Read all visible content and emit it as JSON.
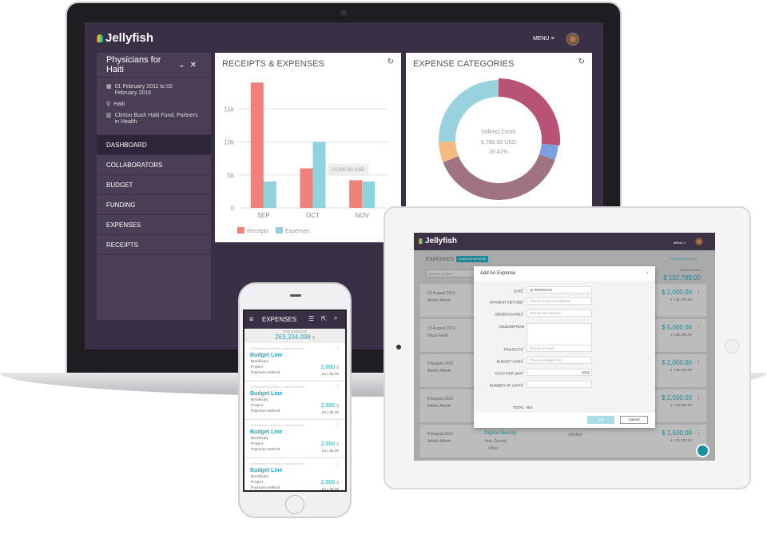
{
  "laptop": {
    "brand": "Jellyfish",
    "menu_label": "MENU",
    "project": "Physicians for Haiti",
    "dates": "01 February 2011 to 02 February 2016",
    "location": "Haiti",
    "funders": "Clinton Bush Haiti Fund, Partners in Health",
    "nav": [
      "DASHBOARD",
      "COLLABORATORS",
      "BUDGET",
      "FUNDING",
      "EXPENSES",
      "RECEIPTS"
    ],
    "active_nav": "DASHBOARD"
  },
  "chart_data": [
    {
      "type": "bar",
      "title": "RECEIPTS & EXPENSES",
      "categories": [
        "SEP",
        "OCT",
        "NOV"
      ],
      "series": [
        {
          "name": "Receipts",
          "values": [
            19000,
            6000,
            4200
          ],
          "color": "#f0817b"
        },
        {
          "name": "Expenses",
          "values": [
            4000,
            10000,
            4000
          ],
          "color": "#8fd3df"
        }
      ],
      "yticks": [
        0,
        5000,
        10000,
        15000
      ],
      "ytick_labels": [
        "0",
        "5k",
        "10k",
        "15k"
      ],
      "ylim": [
        0,
        20000
      ],
      "grid": true,
      "legend": "bottom-left",
      "tooltip": "10,000.00 USD"
    },
    {
      "type": "pie",
      "title": "EXPENSE CATEGORIES",
      "slices": [
        {
          "value": 26.41,
          "color": "#b85377"
        },
        {
          "value": 4,
          "color": "#7c9fe0"
        },
        {
          "value": 38.5,
          "color": "#a07382"
        },
        {
          "value": 5.5,
          "color": "#f4bb7f"
        },
        {
          "value": 25.59,
          "color": "#97d2de"
        }
      ],
      "center_label": "Indirect Costs",
      "center_value": "6,789.00 USD",
      "center_percent": "26.41%"
    }
  ],
  "tablet": {
    "brand": "Jellyfish",
    "menu_label": "MENU",
    "page_title": "EXPENSES",
    "add_button": "ADD AN EXPENSE",
    "export": "EXPORT AS CSV",
    "project_placeholder": "Choose project",
    "total_label": "Total Expenses",
    "total_value": "$ 102,799.00",
    "rows": [
      {
        "date": "23 August 2016",
        "user": "Admin Admin",
        "amount": "$ 2,000.00",
        "detail": "2 x $1,000.00"
      },
      {
        "date": "13 August 2016",
        "user": "Haya Farah",
        "amount": "$ 5,000.00",
        "detail": "1 x $5,000.00"
      },
      {
        "date": "9 August 2016",
        "user": "Admin Admin",
        "amount": "$ 2,000.00",
        "detail": "1 x $2,000.00"
      },
      {
        "date": "8 August 2016",
        "user": "Admin Admin",
        "amount": "$ 2,500.00",
        "detail": "1 x $2,500.00"
      },
      {
        "date": "8 August 2016",
        "user": "Admin Admin",
        "amount": "$ 1,500.00",
        "detail": "1 x $1,500.00",
        "title": "Digital Identity",
        "person": "Joey Zeenny",
        "category": "Other",
        "org": "Jellyfish"
      }
    ],
    "dialog": {
      "title": "Add An Expense",
      "fields": [
        {
          "label": "DATE",
          "value": "06/09/2016",
          "required": true
        },
        {
          "label": "PAYMENT METHOD",
          "placeholder": "Choose Payment Method",
          "required": true
        },
        {
          "label": "BENEFICIARIES",
          "placeholder": "Choose Beneficiary",
          "required": true
        },
        {
          "label": "DESCRIPTION",
          "placeholder": "",
          "required": false,
          "textarea": true
        },
        {
          "label": "PROJECTS",
          "placeholder": "Choose Project",
          "required": true
        },
        {
          "label": "BUDGET LINES",
          "placeholder": "Choose Budget Line",
          "required": true
        },
        {
          "label": "COST PER UNIT",
          "placeholder": "",
          "required": true
        },
        {
          "label": "NUMBER OF UNITS",
          "placeholder": "",
          "required": true
        }
      ],
      "total_label": "TOTAL",
      "total_value": "N/A",
      "add": "Add",
      "cancel": "Cancel"
    }
  },
  "phone": {
    "title": "EXPENSES",
    "total_label": "Total Expenses",
    "total_value": "263,334.098",
    "currency": "$",
    "items": [
      {
        "meta": "19 November 2016 by Joanna Zeenny",
        "title": "Budget Line",
        "beneficiary": "Benificiary",
        "project": "Project",
        "method": "Payment method",
        "amount": "2,000",
        "currency": "$",
        "detail": "24 x $1.00"
      },
      {
        "meta": "19 November 2016 by Joanna Zeenny",
        "title": "Budget Line",
        "beneficiary": "Benificiary",
        "project": "Project",
        "method": "Payment method",
        "amount": "2,000",
        "currency": "$",
        "detail": "24 x $1.00"
      },
      {
        "meta": "19 November 2016 by Joanna Zeenny",
        "title": "Budget Line",
        "beneficiary": "Benificiary",
        "project": "Project",
        "method": "Payment method",
        "amount": "2,000",
        "currency": "$",
        "detail": "24 x $1.00"
      },
      {
        "meta": "19 November 2016 by Joanna Zeenny",
        "title": "Budget Line",
        "beneficiary": "Benificiary",
        "project": "Project",
        "method": "Payment method",
        "amount": "2,000",
        "currency": "$",
        "detail": "24 x $1.00"
      }
    ]
  },
  "colors": {
    "header": "#3a3045",
    "sidebar": "#4a3e56",
    "accent": "#2aa7b8"
  }
}
